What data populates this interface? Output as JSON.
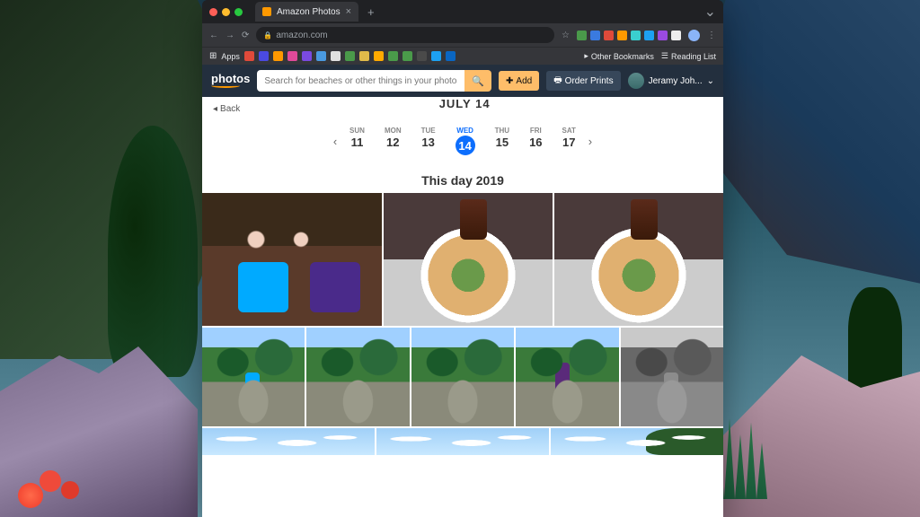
{
  "browser": {
    "tab_title": "Amazon Photos",
    "url_display": "amazon.com",
    "apps_label": "Apps",
    "other_bookmarks": "Other Bookmarks",
    "reading_list": "Reading List",
    "ext_colors": [
      "#4a9a4a",
      "#3a7ae0",
      "#e04a3a",
      "#ff9900",
      "#3acfcf",
      "#1da1f2",
      "#9a4ae0",
      "#eee"
    ],
    "bm_colors": [
      "#e04a3a",
      "#4a4ae0",
      "#ff9900",
      "#e04a9a",
      "#7a4ae0",
      "#4a9ae0",
      "#e0e0e0",
      "#4a9a4a",
      "#e0bb4a",
      "#ffaa00",
      "#4a9a4a",
      "#4a9a4a",
      "#4a4a4a",
      "#1da1f2",
      "#0a66c2"
    ]
  },
  "header": {
    "logo": "photos",
    "search_placeholder": "Search for beaches or other things in your photos...",
    "add": "Add",
    "order_prints": "Order Prints",
    "user_name": "Jeramy Joh..."
  },
  "page": {
    "back": "Back",
    "title_month": "JULY 14",
    "year_section": "This day 2019",
    "days": [
      {
        "dow": "SUN",
        "num": "11"
      },
      {
        "dow": "MON",
        "num": "12"
      },
      {
        "dow": "TUE",
        "num": "13"
      },
      {
        "dow": "WED",
        "num": "14",
        "selected": true
      },
      {
        "dow": "THU",
        "num": "15"
      },
      {
        "dow": "FRI",
        "num": "16"
      },
      {
        "dow": "SAT",
        "num": "17"
      }
    ]
  }
}
